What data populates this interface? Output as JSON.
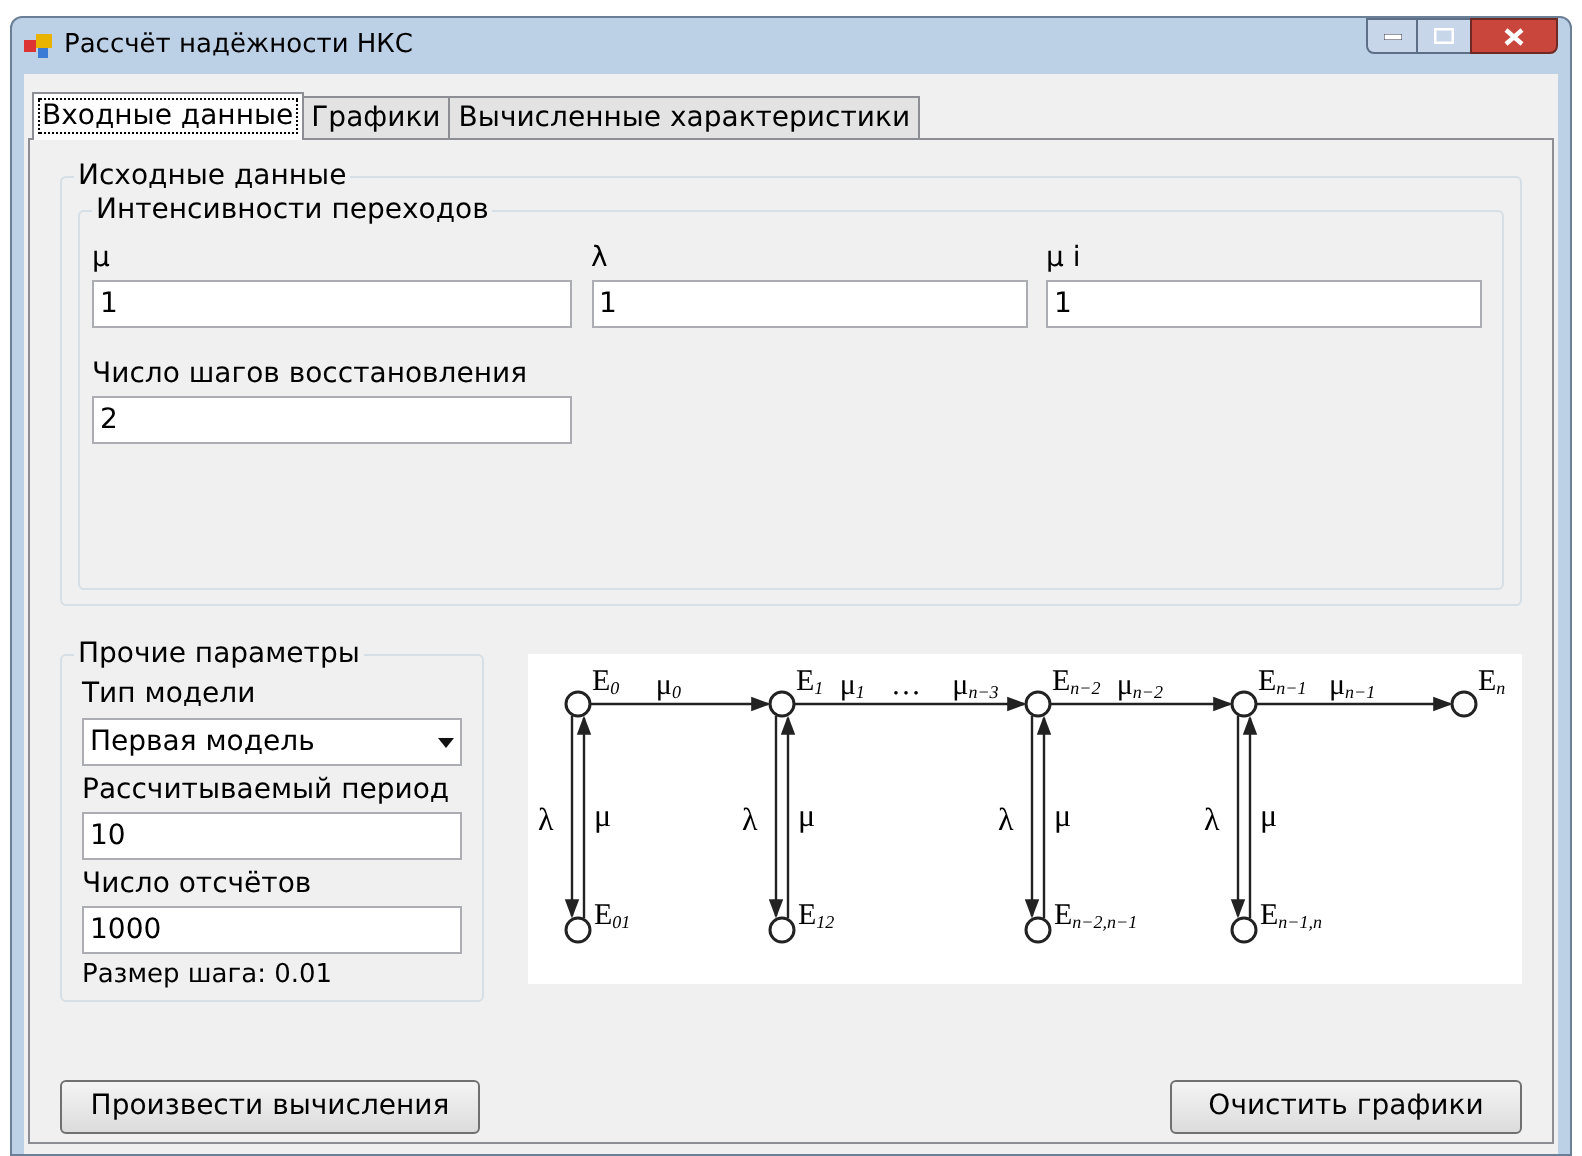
{
  "window": {
    "title": "Рассчёт надёжности НКС"
  },
  "tabs": [
    {
      "label": "Входные данные",
      "selected": true
    },
    {
      "label": "Графики",
      "selected": false
    },
    {
      "label": "Вычисленные характеристики",
      "selected": false
    }
  ],
  "source_group": {
    "title": "Исходные данные",
    "rates_group": {
      "title": "Интенсивности переходов",
      "fields": [
        {
          "label": "μ",
          "value": "1"
        },
        {
          "label": "λ",
          "value": "1"
        },
        {
          "label": "μ i",
          "value": "1"
        }
      ]
    },
    "steps": {
      "label": "Число шагов восстановления",
      "value": "2"
    }
  },
  "other_group": {
    "title": "Прочие параметры",
    "model": {
      "label": "Тип модели",
      "value": "Первая модель"
    },
    "period": {
      "label": "Рассчитываемый период",
      "value": "10"
    },
    "samples": {
      "label": "Число отсчётов",
      "value": "1000"
    },
    "step_size": "Размер шага: 0.01"
  },
  "diagram": {
    "states": [
      {
        "label": "E$_{0}$",
        "edge_labels": [
          "μ$_{0}$"
        ],
        "repair": {
          "down": "λ",
          "up": "μ",
          "label": "E$_{01}$"
        }
      },
      {
        "label": "E$_{1}$",
        "edge_labels": [
          "μ$_{1}$",
          "…",
          "μ$_{n−3}$"
        ],
        "repair": {
          "down": "λ",
          "up": "μ",
          "label": "E$_{12}$"
        }
      },
      {
        "label": "E$_{n−2}$",
        "edge_labels": [
          "μ$_{n−2}$"
        ],
        "repair": {
          "down": "λ",
          "up": "μ",
          "label": "E$_{n−2,n−1}$"
        }
      },
      {
        "label": "E$_{n−1}$",
        "edge_labels": [
          "μ$_{n−1}$"
        ],
        "repair": {
          "down": "λ",
          "up": "μ",
          "label": "E$_{n−1,n}$"
        }
      },
      {
        "label": "E$_{n}$"
      }
    ]
  },
  "buttons": [
    {
      "label": "Произвести вычисления"
    },
    {
      "label": "Очистить графики"
    }
  ]
}
